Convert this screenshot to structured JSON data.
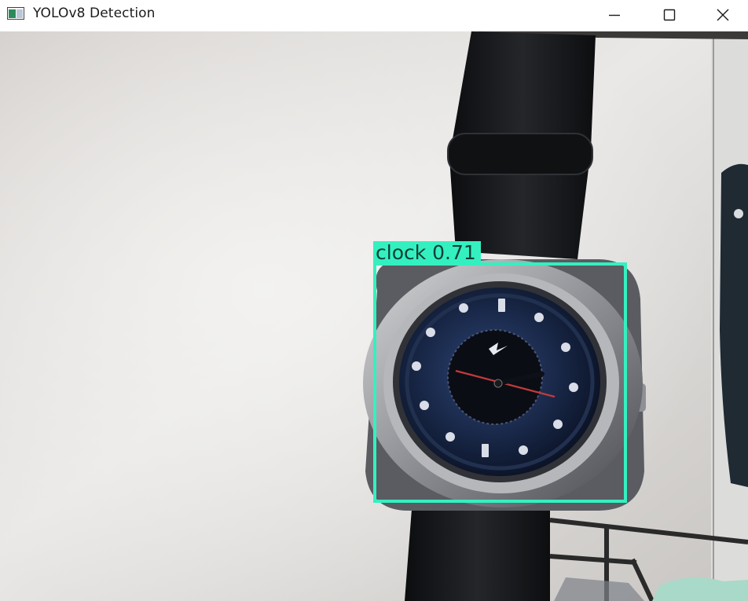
{
  "window": {
    "title": "YOLOv8 Detection",
    "controls": {
      "minimize": "minimize-icon",
      "maximize": "maximize-icon",
      "close": "close-icon"
    }
  },
  "detection": {
    "label": "clock 0.71",
    "class_name": "clock",
    "confidence": 0.71,
    "box_color": "#34f0c0"
  },
  "scene": {
    "icons": [
      "wrist-watch",
      "watch-strap",
      "shelf-rack",
      "hanging-cloth"
    ]
  }
}
